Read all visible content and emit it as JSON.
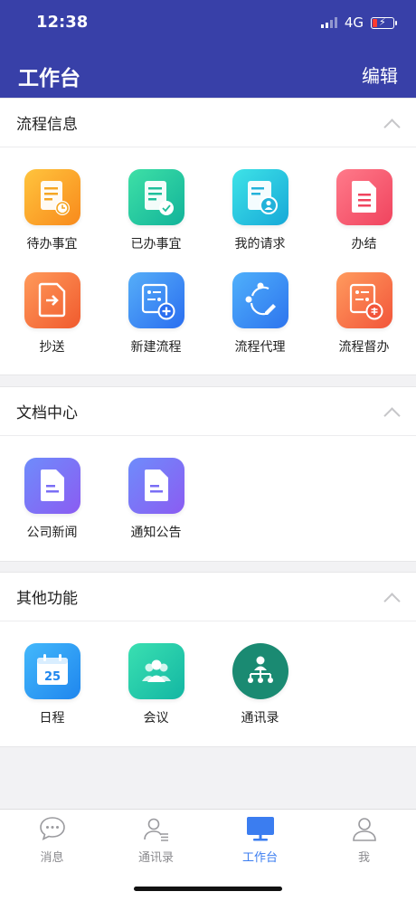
{
  "status": {
    "time": "12:38",
    "network": "4G"
  },
  "header": {
    "title": "工作台",
    "edit_label": "编辑"
  },
  "sections": [
    {
      "title": "流程信息",
      "items": [
        {
          "label": "待办事宜",
          "icon": "pending-doc-clock-icon"
        },
        {
          "label": "已办事宜",
          "icon": "done-doc-check-icon"
        },
        {
          "label": "我的请求",
          "icon": "doc-user-icon"
        },
        {
          "label": "办结",
          "icon": "doc-finished-icon"
        },
        {
          "label": "抄送",
          "icon": "doc-forward-icon"
        },
        {
          "label": "新建流程",
          "icon": "flow-add-icon"
        },
        {
          "label": "流程代理",
          "icon": "flow-proxy-icon"
        },
        {
          "label": "流程督办",
          "icon": "flow-supervise-icon"
        }
      ]
    },
    {
      "title": "文档中心",
      "items": [
        {
          "label": "公司新闻",
          "icon": "news-doc-icon"
        },
        {
          "label": "通知公告",
          "icon": "notice-doc-icon"
        }
      ]
    },
    {
      "title": "其他功能",
      "items": [
        {
          "label": "日程",
          "icon": "calendar-icon",
          "date": "25"
        },
        {
          "label": "会议",
          "icon": "meeting-people-icon"
        },
        {
          "label": "通讯录",
          "icon": "org-chart-icon"
        }
      ]
    }
  ],
  "tabbar": [
    {
      "label": "消息",
      "icon": "chat-bubble-icon",
      "active": false
    },
    {
      "label": "通讯录",
      "icon": "contacts-icon",
      "active": false
    },
    {
      "label": "工作台",
      "icon": "monitor-icon",
      "active": true
    },
    {
      "label": "我",
      "icon": "person-icon",
      "active": false
    }
  ],
  "colors": {
    "header_bg": "#3840a8",
    "tab_active": "#3b7df0"
  }
}
